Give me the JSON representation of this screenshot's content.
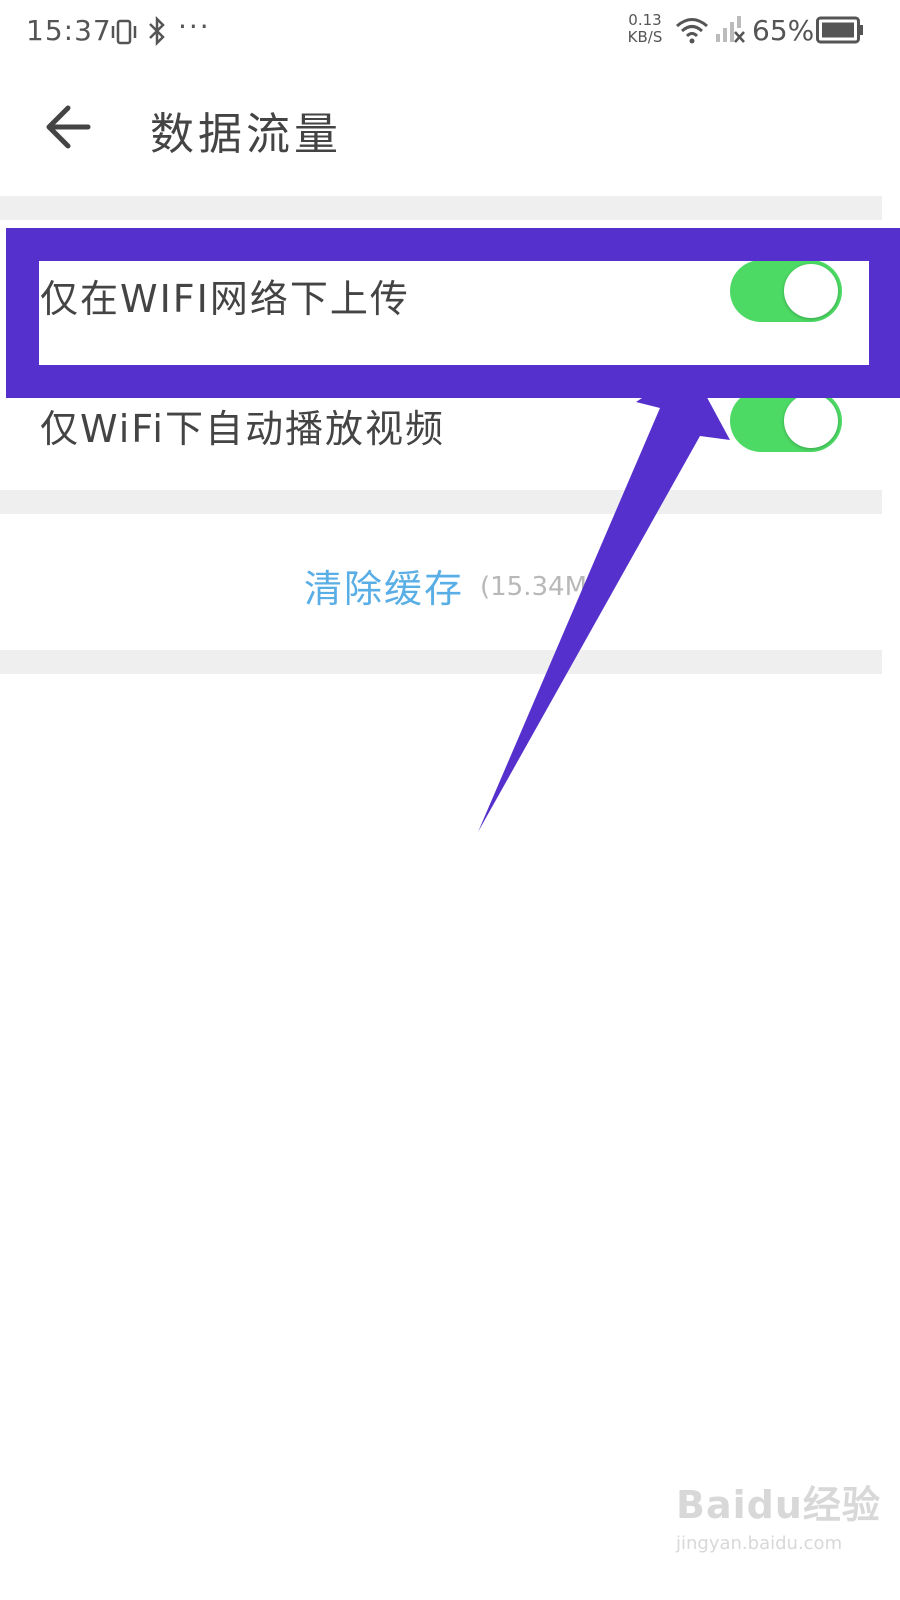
{
  "status_bar": {
    "time": "15:37",
    "more": "···",
    "speed_value": "0.13",
    "speed_unit": "KB/S",
    "battery": "65%",
    "icons": [
      "vibrate-icon",
      "bluetooth-icon",
      "wifi-icon",
      "signal-icon",
      "battery-icon"
    ]
  },
  "header": {
    "title": "数据流量",
    "back_icon": "arrow-left-icon"
  },
  "settings": [
    {
      "label": "仅在WIFI网络下上传",
      "on": true
    },
    {
      "label": "仅WiFi下自动播放视频",
      "on": true
    }
  ],
  "cache": {
    "button_label": "清除缓存",
    "size": "(15.34MB)"
  },
  "colors": {
    "toggle_on": "#4cd964",
    "annotation": "#5630cc",
    "link": "#5aaee6"
  },
  "watermark": {
    "main": "Baidu经验",
    "sub": "jingyan.baidu.com"
  }
}
